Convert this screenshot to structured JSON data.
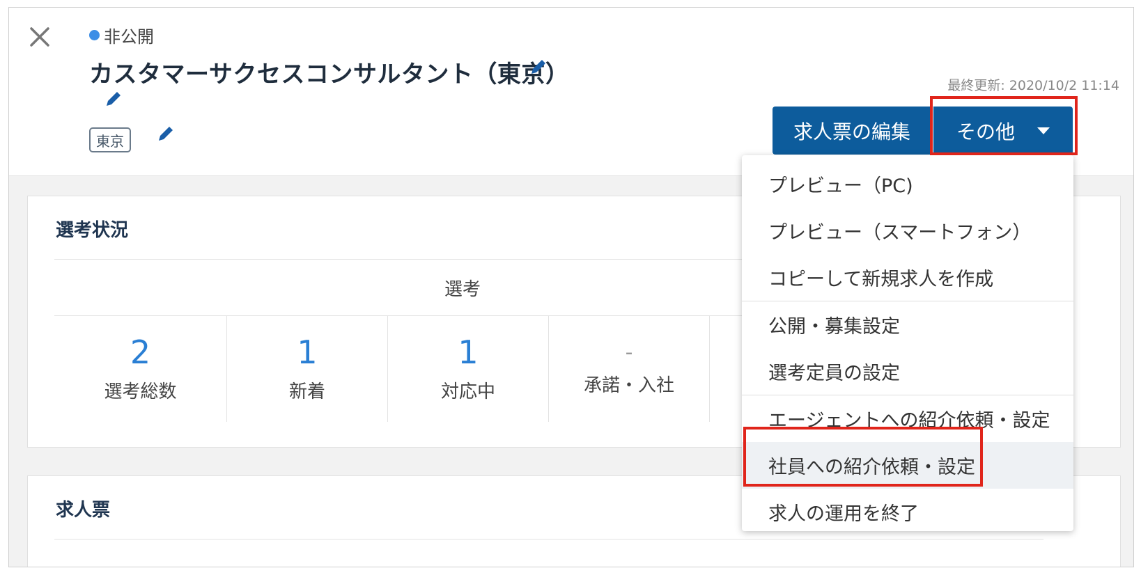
{
  "header": {
    "status": "非公開",
    "title": "カスタマーサクセスコンサルタント（東京）",
    "tag": "東京",
    "last_updated": "最終更新: 2020/10/2 11:14",
    "edit_button": "求人票の編集",
    "more_button": "その他"
  },
  "selection_card": {
    "title": "選考状況",
    "group_header": "選考",
    "stats": [
      {
        "value": "2",
        "label": "選考総数"
      },
      {
        "value": "1",
        "label": "新着"
      },
      {
        "value": "1",
        "label": "対応中"
      },
      {
        "value": "-",
        "label": "承諾・入社"
      }
    ]
  },
  "job_card": {
    "title": "求人票"
  },
  "dropdown": {
    "groups": [
      [
        "プレビュー（PC)",
        "プレビュー（スマートフォン）",
        "コピーして新規求人を作成"
      ],
      [
        "公開・募集設定",
        "選考定員の設定"
      ],
      [
        "エージェントへの紹介依頼・設定",
        "社員への紹介依頼・設定",
        "求人の運用を終了"
      ]
    ]
  },
  "colors": {
    "primary": "#0d5c9c",
    "status_dot": "#3d8ee6",
    "stat_number": "#2a7fd4",
    "highlight_box": "#e0251b"
  },
  "icons": [
    "close-icon",
    "pencil-icon",
    "caret-down-icon"
  ]
}
